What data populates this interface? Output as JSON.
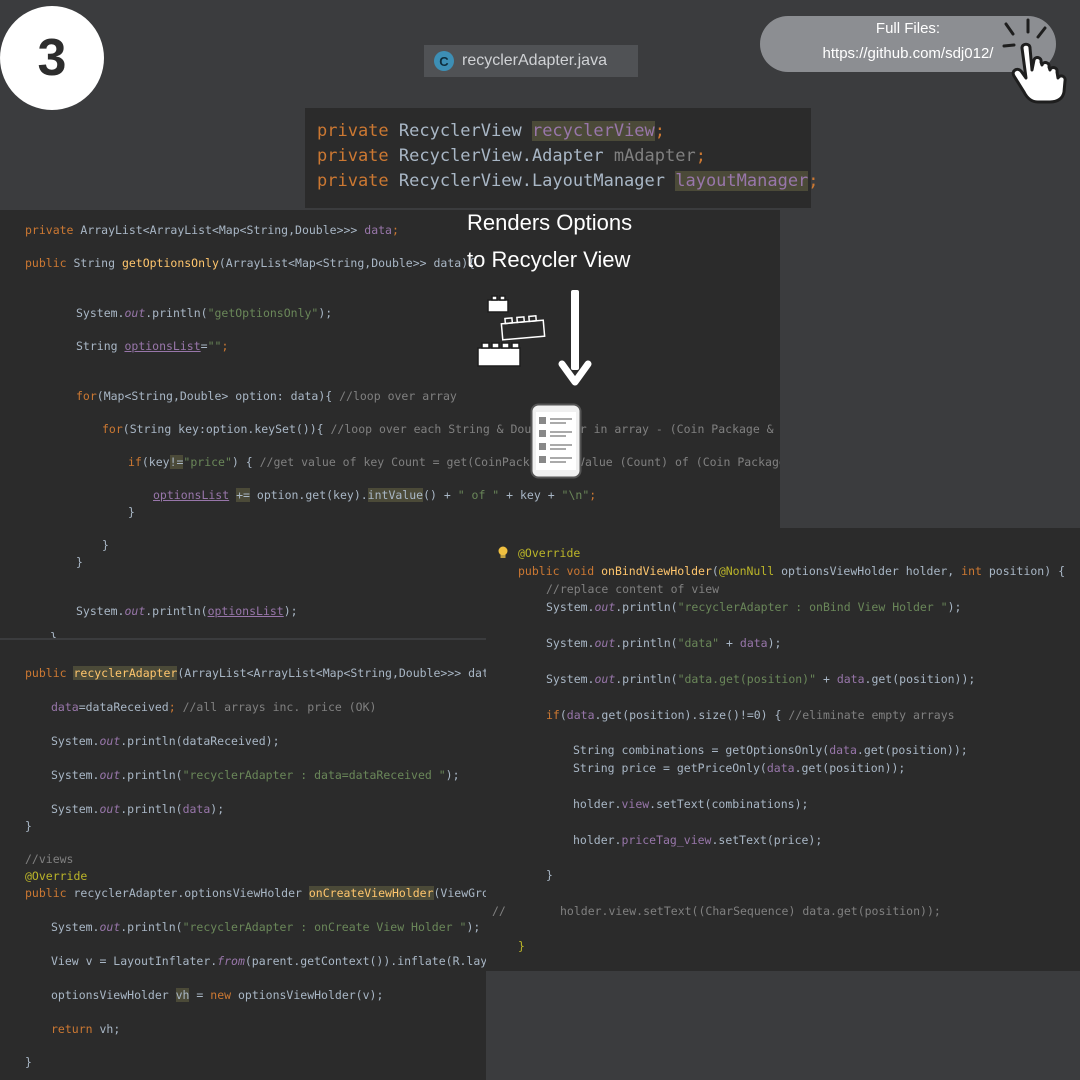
{
  "step": {
    "number": "3"
  },
  "file_tab": {
    "icon": "class-c-icon",
    "icon_letter": "C",
    "name": "recyclerAdapter.java"
  },
  "link": {
    "line1": "Full Files:",
    "line2": "https://github.com/sdj012/"
  },
  "caption": {
    "line1": "Renders Options",
    "line2": "to Recycler View"
  },
  "colors": {
    "background": "#3b3c3e",
    "editor": "#2b2b2b",
    "keyword": "#cc7832",
    "method": "#ffc66d",
    "string": "#6a8759",
    "comment": "#808080",
    "field": "#9876aa",
    "annotation": "#bbb529"
  },
  "top_fields": [
    [
      [
        "k",
        "private "
      ],
      [
        "t",
        "RecyclerView "
      ],
      [
        "hp",
        "recyclerView"
      ],
      [
        "k",
        ";"
      ]
    ],
    [
      [
        "k",
        "private "
      ],
      [
        "t",
        "RecyclerView.Adapter "
      ],
      [
        "c",
        "mAdapter"
      ],
      [
        "k",
        ";"
      ]
    ],
    [
      [
        "k",
        "private "
      ],
      [
        "t",
        "RecyclerView.LayoutManager "
      ],
      [
        "hp",
        "layoutManager"
      ],
      [
        "k",
        ";"
      ]
    ]
  ],
  "left_code_top": [
    [
      [
        "k",
        "private "
      ],
      [
        "t",
        "ArrayList<ArrayList<Map<String,Double>>> "
      ],
      [
        "p",
        "data"
      ],
      [
        "k",
        ";"
      ]
    ],
    [
      [
        "k",
        "public "
      ],
      [
        "t",
        "String "
      ],
      [
        "f",
        "getOptionsOnly"
      ],
      [
        "t",
        "(ArrayList<Map<String,Double>> data){"
      ]
    ],
    [
      [
        "t",
        "System."
      ],
      [
        "i",
        "out"
      ],
      [
        "t",
        ".println("
      ],
      [
        "s",
        "\"getOptionsOnly\""
      ],
      [
        "t",
        ");"
      ]
    ],
    [
      [
        "t",
        "String "
      ],
      [
        "u",
        "optionsList"
      ],
      [
        "t",
        "="
      ],
      [
        "s",
        "\"\""
      ],
      [
        "k",
        ";"
      ]
    ],
    [
      [
        "k",
        "for"
      ],
      [
        "t",
        "(Map<String,Double> option: data){ "
      ],
      [
        "c",
        "//loop over array"
      ]
    ],
    [
      [
        "k",
        "for"
      ],
      [
        "t",
        "(String key:option.keySet()){ "
      ],
      [
        "c",
        "//loop over each String & Double pair in array - (Coin Package & Count)"
      ]
    ],
    [
      [
        "k",
        "if"
      ],
      [
        "t",
        "(key"
      ],
      [
        "h",
        "!="
      ],
      [
        "s",
        "\"price\""
      ],
      [
        "t",
        ") { "
      ],
      [
        "c",
        "//get value of key Count = get(CoinPackage) - Value (Count) of (Coin Package)"
      ]
    ],
    [
      [
        "u",
        "optionsList"
      ],
      [
        "t",
        " "
      ],
      [
        "h",
        "+="
      ],
      [
        "t",
        " option.get(key)."
      ],
      [
        "h",
        "intValue"
      ],
      [
        "t",
        "() + "
      ],
      [
        "s",
        "\" of \""
      ],
      [
        "t",
        " + key + "
      ],
      [
        "s",
        "\"\\n\""
      ],
      [
        "k",
        ";"
      ]
    ],
    [
      [
        "t",
        "}"
      ]
    ],
    [
      [
        "t",
        "}"
      ]
    ],
    [
      [
        "t",
        "}"
      ]
    ],
    [
      [
        "t",
        "System."
      ],
      [
        "i",
        "out"
      ],
      [
        "t",
        ".println("
      ],
      [
        "u",
        "optionsList"
      ],
      [
        "t",
        ");"
      ]
    ],
    [
      [
        "t",
        "}"
      ]
    ]
  ],
  "left_code_bottom": [
    [
      [
        "k",
        "public "
      ],
      [
        "hf",
        "recyclerAdapter"
      ],
      [
        "t",
        "(ArrayList<ArrayList<Map<String,Double>>> dataReceived){"
      ]
    ],
    [
      [
        "p",
        "data"
      ],
      [
        "t",
        "=dataReceived"
      ],
      [
        "k",
        "; "
      ],
      [
        "c",
        "//all arrays inc. price (OK)"
      ]
    ],
    [
      [
        "t",
        "System."
      ],
      [
        "i",
        "out"
      ],
      [
        "t",
        ".println(dataReceived);"
      ]
    ],
    [
      [
        "t",
        "System."
      ],
      [
        "i",
        "out"
      ],
      [
        "t",
        ".println("
      ],
      [
        "s",
        "\"recyclerAdapter : data=dataReceived \""
      ],
      [
        "t",
        ");"
      ]
    ],
    [
      [
        "t",
        "System."
      ],
      [
        "i",
        "out"
      ],
      [
        "t",
        ".println("
      ],
      [
        "p",
        "data"
      ],
      [
        "t",
        ");"
      ]
    ],
    [
      [
        "t",
        "}"
      ]
    ],
    [
      [
        "c",
        "//views"
      ]
    ],
    [
      [
        "a",
        "@Override"
      ]
    ],
    [
      [
        "k",
        "public "
      ],
      [
        "t",
        "recyclerAdapter.optionsViewHolder "
      ],
      [
        "hf",
        "onCreateViewHolder"
      ],
      [
        "t",
        "(ViewGroup parent, int viewType) {"
      ]
    ],
    [
      [
        "t",
        "System."
      ],
      [
        "i",
        "out"
      ],
      [
        "t",
        ".println("
      ],
      [
        "s",
        "\"recyclerAdapter : onCreate View Holder \""
      ],
      [
        "t",
        ");"
      ]
    ],
    [
      [
        "t",
        "View v = LayoutInflater."
      ],
      [
        "i",
        "from"
      ],
      [
        "t",
        "(parent.getContext()).inflate(R.layout.options_layout, parent, false);"
      ]
    ],
    [
      [
        "t",
        "optionsViewHolder "
      ],
      [
        "h",
        "vh"
      ],
      [
        "t",
        " = "
      ],
      [
        "k",
        "new "
      ],
      [
        "t",
        "optionsViewHolder(v);"
      ]
    ],
    [
      [
        "k",
        "return "
      ],
      [
        "t",
        "vh;"
      ]
    ],
    [
      [
        "t",
        "}"
      ]
    ]
  ],
  "right_code": [
    [
      [
        "a",
        "@Override"
      ]
    ],
    [
      [
        "k",
        "public void "
      ],
      [
        "f",
        "onBindViewHolder"
      ],
      [
        "t",
        "("
      ],
      [
        "a",
        "@NonNull "
      ],
      [
        "t",
        "optionsViewHolder holder, "
      ],
      [
        "k",
        "int "
      ],
      [
        "t",
        "position) {"
      ]
    ],
    [
      [
        "c",
        "//replace content of view"
      ]
    ],
    [
      [
        "t",
        "System."
      ],
      [
        "i",
        "out"
      ],
      [
        "t",
        ".println("
      ],
      [
        "s",
        "\"recyclerAdapter : onBind View Holder \""
      ],
      [
        "t",
        ");"
      ]
    ],
    [
      [
        "t",
        "System."
      ],
      [
        "i",
        "out"
      ],
      [
        "t",
        ".println("
      ],
      [
        "s",
        "\"data\""
      ],
      [
        "t",
        " + "
      ],
      [
        "p",
        "data"
      ],
      [
        "t",
        ");"
      ]
    ],
    [
      [
        "t",
        "System."
      ],
      [
        "i",
        "out"
      ],
      [
        "t",
        ".println("
      ],
      [
        "s",
        "\"data.get(position)\""
      ],
      [
        "t",
        " + "
      ],
      [
        "p",
        "data"
      ],
      [
        "t",
        ".get(position));"
      ]
    ],
    [
      [
        "k",
        "if"
      ],
      [
        "t",
        "("
      ],
      [
        "p",
        "data"
      ],
      [
        "t",
        ".get(position).size()!=0) { "
      ],
      [
        "c",
        "//eliminate empty arrays"
      ]
    ],
    [
      [
        "t",
        "String combinations = getOptionsOnly("
      ],
      [
        "p",
        "data"
      ],
      [
        "t",
        ".get(position));"
      ]
    ],
    [
      [
        "t",
        "String price = getPriceOnly("
      ],
      [
        "p",
        "data"
      ],
      [
        "t",
        ".get(position));"
      ]
    ],
    [
      [
        "t",
        "holder."
      ],
      [
        "p",
        "view"
      ],
      [
        "t",
        ".setText(combinations);"
      ]
    ],
    [
      [
        "t",
        "holder."
      ],
      [
        "p",
        "priceTag_view"
      ],
      [
        "t",
        ".setText(price);"
      ]
    ],
    [
      [
        "t",
        "}"
      ]
    ],
    [
      [
        "c",
        "//"
      ]
    ],
    [
      [
        "c",
        "holder.view.setText((CharSequence) data.get(position));"
      ]
    ],
    [
      [
        "a",
        "}"
      ]
    ]
  ]
}
